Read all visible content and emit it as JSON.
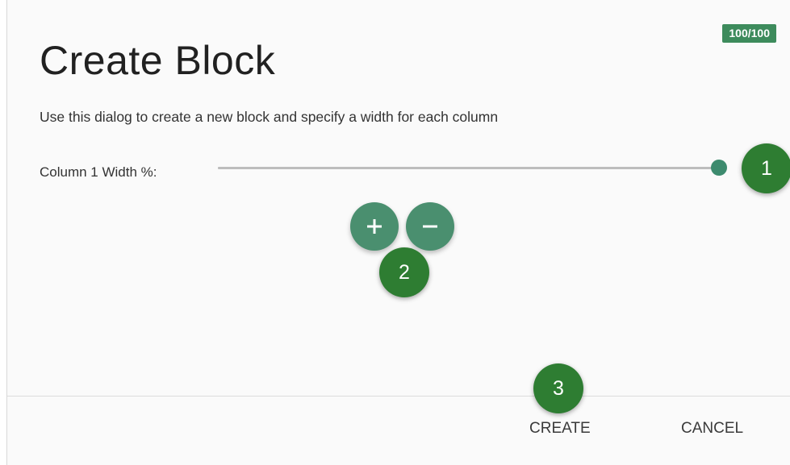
{
  "dialog": {
    "badge": "100/100",
    "title": "Create Block",
    "description": "Use this dialog to create a new block and specify a width for each column",
    "column": {
      "label": "Column 1 Width %:",
      "slider_value_percent": 100
    },
    "add_icon": "plus-icon",
    "remove_icon": "minus-icon",
    "markers": [
      "1",
      "2",
      "3"
    ],
    "actions": {
      "create_label": "CREATE",
      "cancel_label": "CANCEL"
    }
  },
  "colors": {
    "accent": "#3d8b6e",
    "marker": "#2e7d32",
    "badge": "#3d8b5c"
  }
}
